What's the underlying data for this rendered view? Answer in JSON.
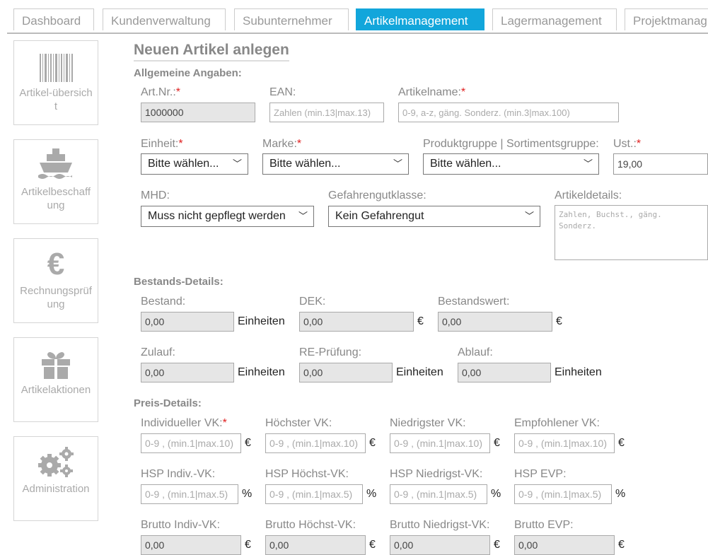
{
  "tabs": [
    {
      "label": "Dashboard"
    },
    {
      "label": "Kundenverwaltung"
    },
    {
      "label": "Subunternehmer"
    },
    {
      "label": "Artikelmanagement"
    },
    {
      "label": "Lagermanagement"
    },
    {
      "label": "Projektmanag"
    }
  ],
  "sidebar": [
    {
      "label": "Artikel-übersicht",
      "icon": "barcode-icon"
    },
    {
      "label": "Artikelbeschaffung",
      "icon": "ship-icon"
    },
    {
      "label": "Rechnungsprüfung",
      "icon": "euro-icon"
    },
    {
      "label": "Artikelaktionen",
      "icon": "gift-icon"
    },
    {
      "label": "Administration",
      "icon": "gears-icon"
    }
  ],
  "title": "Neuen Artikel anlegen",
  "sections": {
    "general": "Allgemeine Angaben:",
    "stock": "Bestands-Details:",
    "price": "Preis-Details:"
  },
  "required_mark": "*",
  "general": {
    "art_nr": {
      "label": "Art.Nr.:",
      "value": "1000000"
    },
    "ean": {
      "label": "EAN:",
      "placeholder": "Zahlen (min.13|max.13)"
    },
    "name": {
      "label": "Artikelname:",
      "placeholder": "0-9, a-z, gäng. Sonderz. (min.3|max.100)"
    },
    "einheit": {
      "label": "Einheit:",
      "value": "Bitte wählen..."
    },
    "marke": {
      "label": "Marke:",
      "value": "Bitte wählen..."
    },
    "gruppe": {
      "label": "Produktgruppe | Sortimentsgruppe:",
      "value": "Bitte wählen..."
    },
    "ust": {
      "label": "Ust.:",
      "value": "19,00"
    },
    "mhd": {
      "label": "MHD:",
      "value": "Muss nicht gepflegt werden"
    },
    "gefahr": {
      "label": "Gefahrengutklasse:",
      "value": "Kein Gefahrengut"
    },
    "details": {
      "label": "Artikeldetails:",
      "placeholder": "Zahlen, Buchst., gäng. Sonderz."
    }
  },
  "stock": {
    "bestand": {
      "label": "Bestand:",
      "value": "0,00",
      "unit": "Einheiten"
    },
    "dek": {
      "label": "DEK:",
      "value": "0,00",
      "unit": "€"
    },
    "wert": {
      "label": "Bestandswert:",
      "value": "0,00",
      "unit": "€"
    },
    "zulauf": {
      "label": "Zulauf:",
      "value": "0,00",
      "unit": "Einheiten"
    },
    "re": {
      "label": "RE-Prüfung:",
      "value": "0,00",
      "unit": "Einheiten"
    },
    "ablauf": {
      "label": "Ablauf:",
      "value": "0,00",
      "unit": "Einheiten"
    }
  },
  "price": {
    "vk_placeholder": "0-9 , (min.1|max.10)",
    "hsp_placeholder": "0-9 , (min.1|max.5)",
    "row1": [
      {
        "label": "Individueller VK:",
        "unit": "€",
        "required": true
      },
      {
        "label": "Höchster VK:",
        "unit": "€"
      },
      {
        "label": "Niedrigster VK:",
        "unit": "€"
      },
      {
        "label": "Empfohlener VK:",
        "unit": "€"
      }
    ],
    "row2": [
      {
        "label": "HSP Indiv.-VK:",
        "unit": "%"
      },
      {
        "label": "HSP Höchst-VK:",
        "unit": "%"
      },
      {
        "label": "HSP Niedrigst-VK:",
        "unit": "%"
      },
      {
        "label": "HSP EVP:",
        "unit": "%"
      }
    ],
    "row3": [
      {
        "label": "Brutto Indiv-VK:",
        "value": "0,00",
        "unit": "€"
      },
      {
        "label": "Brutto Höchst-VK:",
        "value": "0,00",
        "unit": "€"
      },
      {
        "label": "Brutto Niedrigst-VK:",
        "value": "0,00",
        "unit": "€"
      },
      {
        "label": "Brutto EVP:",
        "value": "0,00",
        "unit": "€"
      }
    ]
  }
}
